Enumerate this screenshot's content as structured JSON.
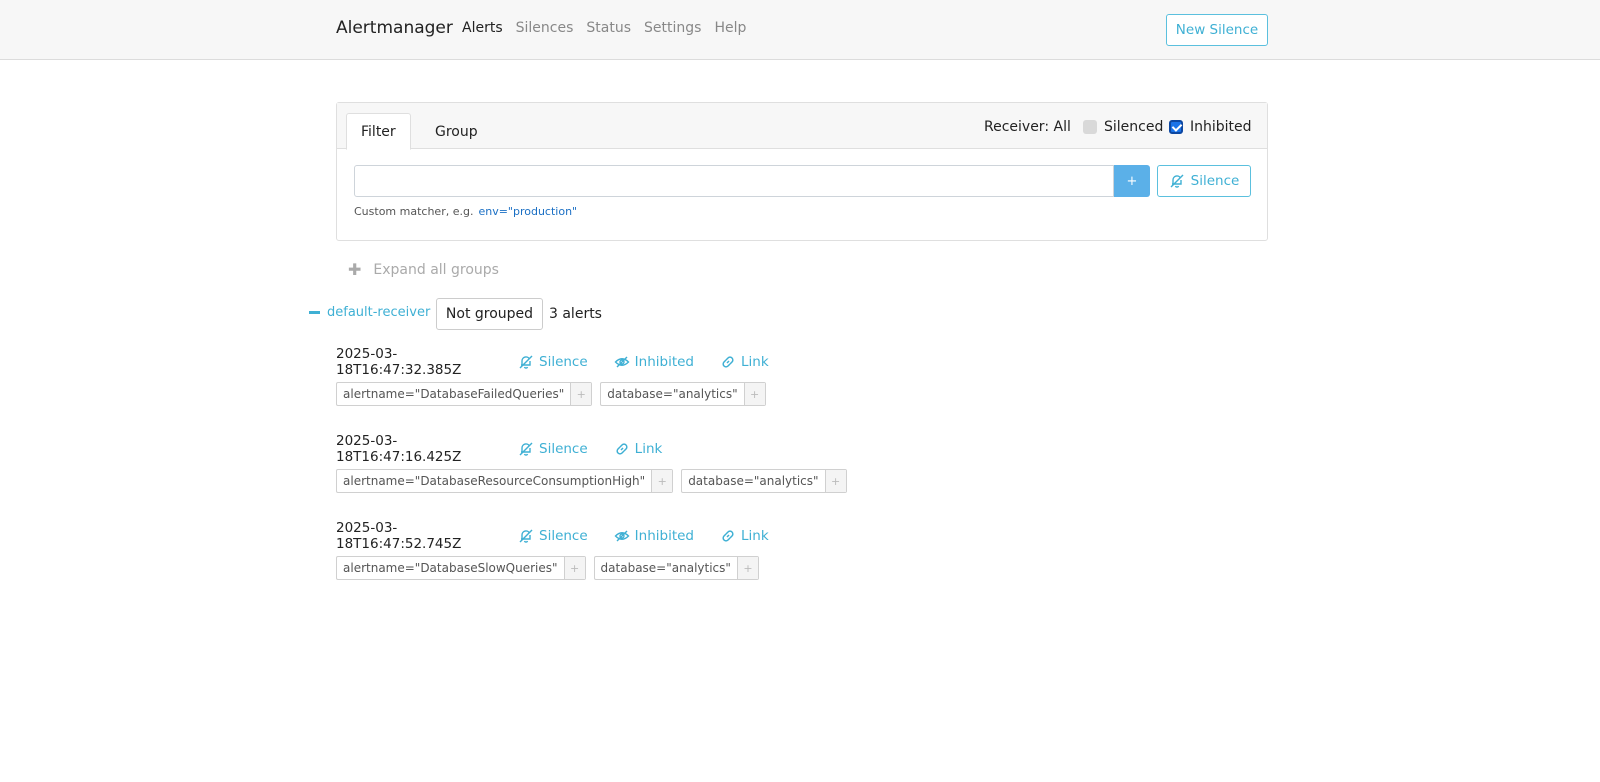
{
  "navbar": {
    "brand": "Alertmanager",
    "links": [
      {
        "label": "Alerts",
        "active": true
      },
      {
        "label": "Silences",
        "active": false
      },
      {
        "label": "Status",
        "active": false
      },
      {
        "label": "Settings",
        "active": false
      },
      {
        "label": "Help",
        "active": false
      }
    ],
    "new_silence_label": "New Silence"
  },
  "filter": {
    "tabs": {
      "filter": "Filter",
      "group": "Group"
    },
    "receiver": "Receiver: All",
    "silenced_label": "Silenced",
    "silenced_checked": false,
    "inhibited_label": "Inhibited",
    "inhibited_checked": true,
    "input_value": "",
    "plus_label": "+",
    "silence_label": "Silence",
    "hint": "Custom matcher, e.g.",
    "hint_example": "env=\"production\""
  },
  "expand_label": "Expand all groups",
  "group": {
    "receiver": "default-receiver",
    "not_grouped_label": "Not grouped",
    "count": "3 alerts"
  },
  "alerts": [
    {
      "timestamp": "2025-03-18T16:47:32.385Z",
      "actions": {
        "silence": "Silence",
        "inhibited": "Inhibited",
        "link": "Link"
      },
      "labels": [
        "alertname=\"DatabaseFailedQueries\"",
        "database=\"analytics\""
      ]
    },
    {
      "timestamp": "2025-03-18T16:47:16.425Z",
      "actions": {
        "silence": "Silence",
        "link": "Link"
      },
      "labels": [
        "alertname=\"DatabaseResourceConsumptionHigh\"",
        "database=\"analytics\""
      ]
    },
    {
      "timestamp": "2025-03-18T16:47:52.745Z",
      "actions": {
        "silence": "Silence",
        "inhibited": "Inhibited",
        "link": "Link"
      },
      "labels": [
        "alertname=\"DatabaseSlowQueries\"",
        "database=\"analytics\""
      ]
    }
  ],
  "label_add": "+",
  "colors": {
    "accent": "#3fb0d4",
    "primary": "#5bb0e8",
    "checkbox": "#1a73e8"
  },
  "icons": {
    "silence": "bell-slash-icon",
    "inhibited": "eye-slash-icon",
    "link": "link-icon"
  }
}
